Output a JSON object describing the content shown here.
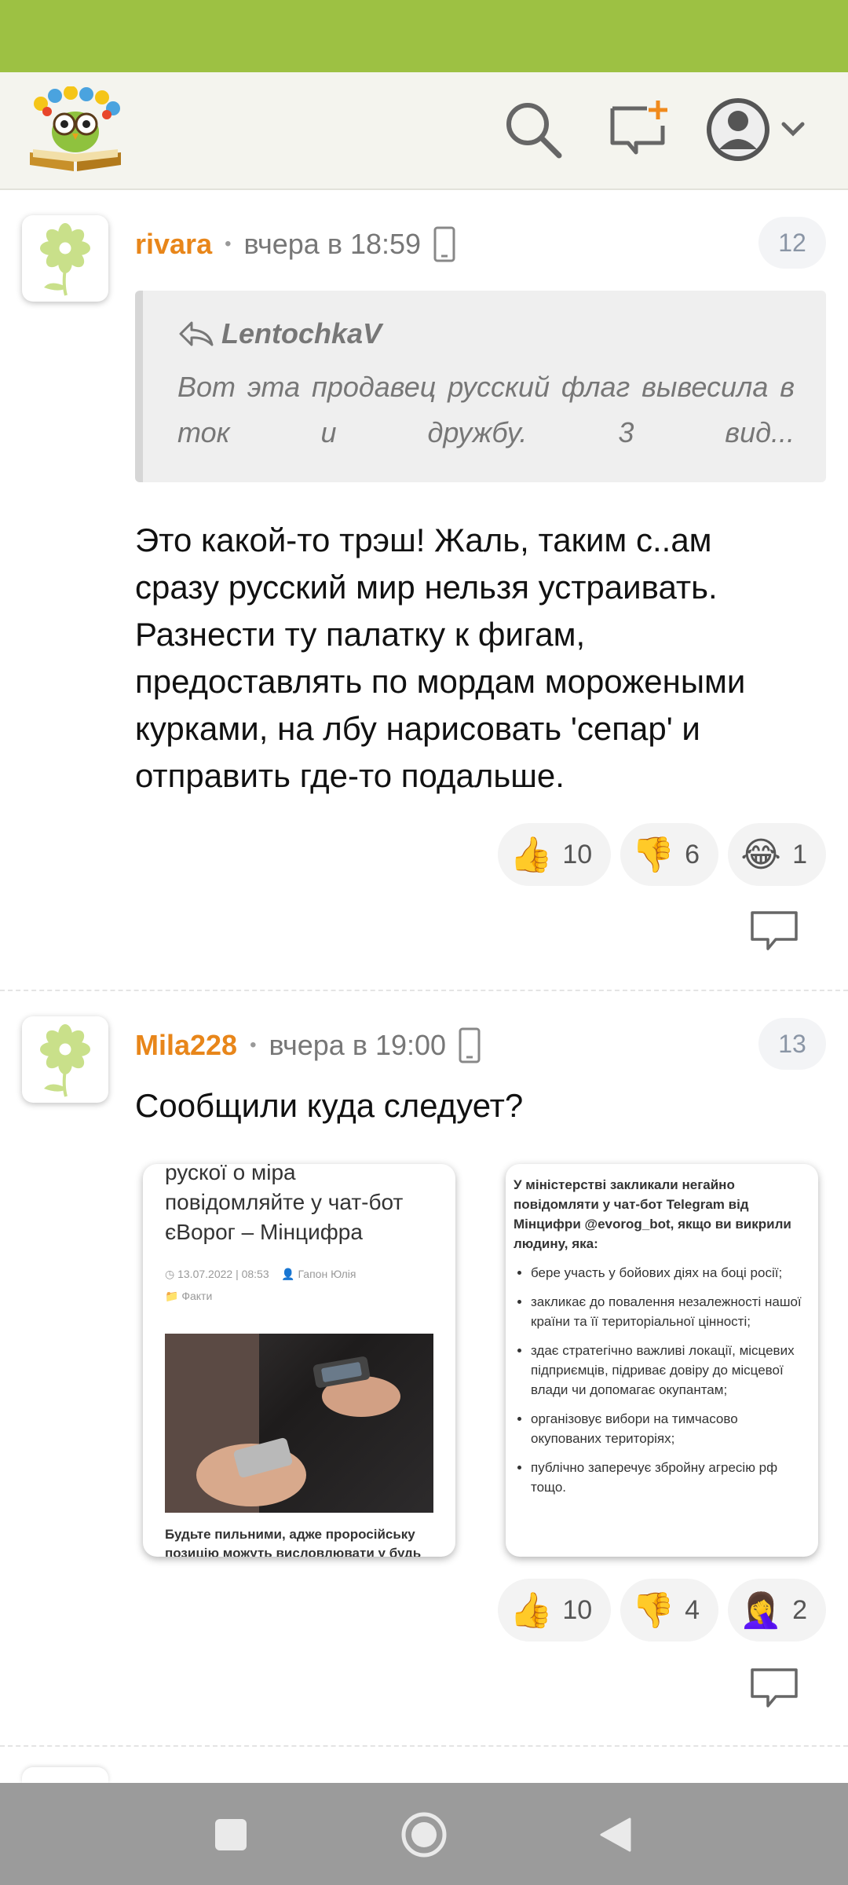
{
  "header": {
    "logo_icon": "book-owl-logo",
    "search_icon": "search-icon",
    "compose_icon": "new-message-icon",
    "avatar_icon": "user-avatar-icon",
    "accent_color": "#9dc143"
  },
  "comments": [
    {
      "username": "rivara",
      "time": "вчера в 18:59",
      "number": "12",
      "quote": {
        "author": "LentochkaV",
        "text": "Вот эта продавец русский флаг вывесила в ток и дружбу. 3 вид..."
      },
      "lines": [
        "Это какой-то трэш! Жаль, таким с..ам",
        "сразу русский мир нельзя устраивать.",
        "Разнести ту палатку к фигам,",
        "предоставлять по мордам морожеными",
        "курками, на лбу нарисовать 'сепар' и",
        "отправить где-то подальше."
      ],
      "reactions": [
        {
          "emoji": "👍",
          "count": "10"
        },
        {
          "emoji": "👎",
          "count": "6"
        },
        {
          "emoji": "😂",
          "count": "1"
        }
      ]
    },
    {
      "username": "Mila228",
      "time": "вчера в 19:00",
      "number": "13",
      "text": "Сообщили куда следует?",
      "images": {
        "left": {
          "title": "рускої о міра повідомляйте у чат-бот єВорог – Мінцифра",
          "date": "◷ 13.07.2022 | 08:53",
          "author": "👤 Гапон Юлія",
          "category": "📁 Факти",
          "caption": "Будьте пильними, адже проросійську позицію можуть висловлювати у будь"
        },
        "right": {
          "heading": "У міністерстві закликали негайно повідомляти у чат-бот Telegram від Мінцифри @evorog_bot, якщо ви викрили людину, яка:",
          "items": [
            "бере участь у бойових діях на боці росії;",
            "закликає до повалення незалежності нашої країни та її територіальної цінності;",
            "здає стратегічно важливі локації, місцевих підприємців, підриває довіру до місцевої влади чи допомагає окупантам;",
            "організовує вибори на тимчасово окупованих територіях;",
            "публічно заперечує збройну агресію рф тощо."
          ]
        }
      },
      "reactions": [
        {
          "emoji": "👍",
          "count": "10"
        },
        {
          "emoji": "👎",
          "count": "4"
        },
        {
          "emoji": "🤦‍♀️",
          "count": "2"
        }
      ]
    }
  ],
  "navbar": {
    "recents_icon": "square-icon",
    "home_icon": "circle-icon",
    "back_icon": "triangle-back-icon"
  }
}
